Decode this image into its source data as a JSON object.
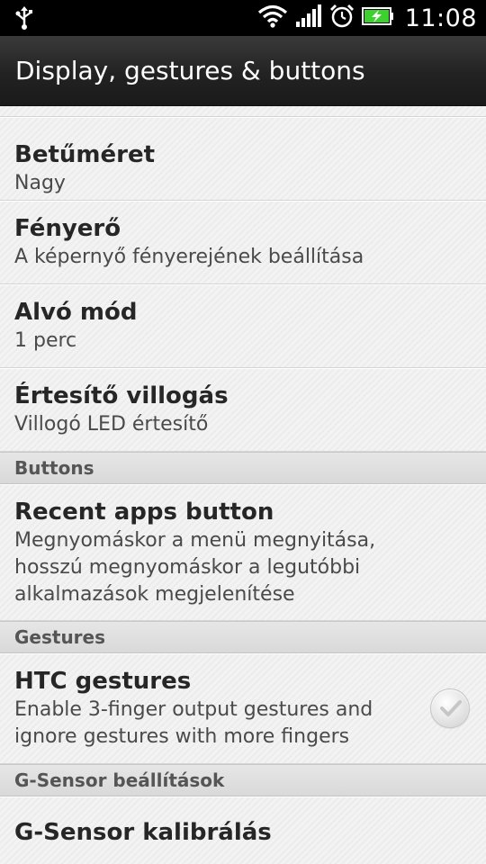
{
  "status_bar": {
    "time": "11:08",
    "icons": [
      "usb-icon",
      "wifi-icon",
      "signal-icon",
      "alarm-icon",
      "battery-charging-icon"
    ]
  },
  "header": {
    "title": "Display, gestures & buttons"
  },
  "items": {
    "font_size": {
      "title": "Betűméret",
      "subtitle": "Nagy"
    },
    "brightness": {
      "title": "Fényerő",
      "subtitle": "A képernyő fényerejének beállítása"
    },
    "sleep": {
      "title": "Alvó mód",
      "subtitle": "1 perc"
    },
    "notification_flash": {
      "title": "Értesítő villogás",
      "subtitle": "Villogó LED értesítő"
    }
  },
  "sections": {
    "buttons": "Buttons",
    "gestures": "Gestures",
    "gsensor": "G-Sensor beállítások"
  },
  "recent_apps": {
    "title": "Recent apps button",
    "line1": "Megnyomáskor a menü megnyitása,",
    "line2": "hosszú megnyomáskor a legutóbbi",
    "line3": "alkalmazások megjelenítése"
  },
  "htc_gestures": {
    "title": "HTC gestures",
    "line1": "Enable 3-finger output gestures and",
    "line2": "ignore gestures with more fingers",
    "checked": false
  },
  "gsensor_calibration": {
    "title": "G-Sensor kalibrálás"
  },
  "colors": {
    "status_bar_bg": "#000000",
    "title_bar_bg": "#222222",
    "battery_charge": "#3cd12e",
    "list_bg": "#efefef",
    "section_bg": "#dcdcdc"
  }
}
